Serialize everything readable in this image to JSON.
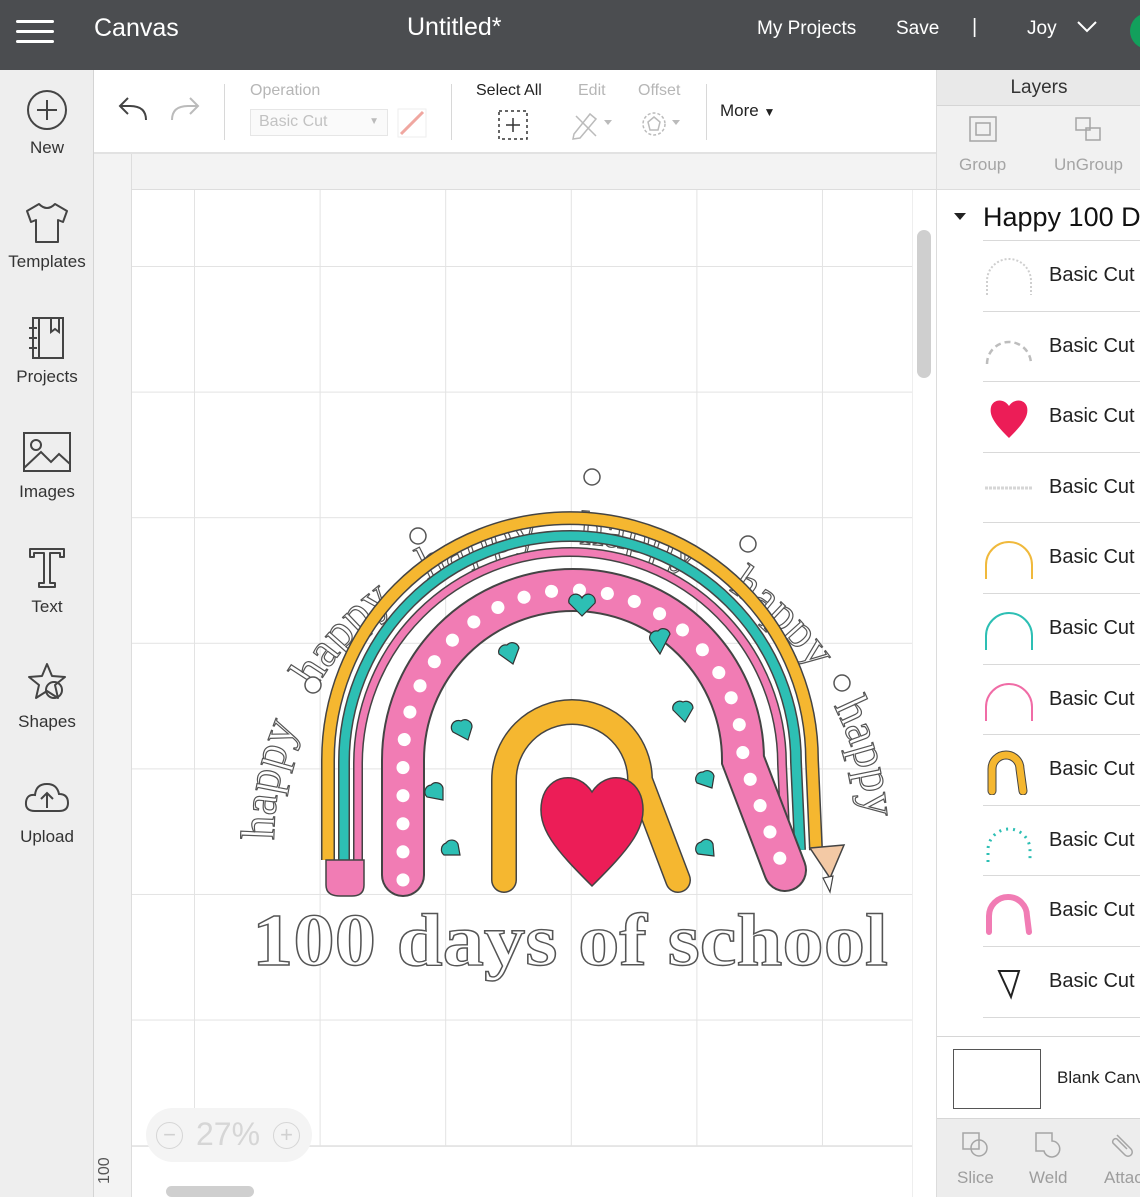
{
  "app": {
    "title": "Canvas",
    "document_title": "Untitled*",
    "nav": {
      "my_projects": "My Projects",
      "save": "Save",
      "separator": "|",
      "user": "Joy"
    }
  },
  "sidebar": {
    "items": [
      {
        "label": "New",
        "icon": "plus-circle-icon"
      },
      {
        "label": "Templates",
        "icon": "tshirt-icon"
      },
      {
        "label": "Projects",
        "icon": "notebook-icon"
      },
      {
        "label": "Images",
        "icon": "image-icon"
      },
      {
        "label": "Text",
        "icon": "text-t-icon"
      },
      {
        "label": "Shapes",
        "icon": "shapes-icon"
      },
      {
        "label": "Upload",
        "icon": "cloud-upload-icon"
      }
    ]
  },
  "toolbar": {
    "operation_label": "Operation",
    "operation_value": "Basic Cut",
    "select_all": "Select All",
    "edit": "Edit",
    "offset": "Offset",
    "more": "More"
  },
  "canvas": {
    "zoom": "27%",
    "ruler_left_label": "100",
    "design": {
      "arc_text": [
        "happy",
        "happy",
        "happy",
        "happy",
        "happy",
        "happy"
      ],
      "title": "100 days of school"
    }
  },
  "layers_panel": {
    "title": "Layers",
    "group_label": "Group",
    "ungroup_label": "UnGroup",
    "group_name": "Happy 100 D",
    "items": [
      {
        "label": "Basic Cut",
        "thumb": "dotted-arc-icon",
        "color": "#cfcfcf"
      },
      {
        "label": "Basic Cut",
        "thumb": "dashed-arc-icon",
        "color": "#bdbdbd"
      },
      {
        "label": "Basic Cut",
        "thumb": "heart-icon",
        "color": "#ec1d57"
      },
      {
        "label": "Basic Cut",
        "thumb": "text-line-icon",
        "color": "#d6d6d6"
      },
      {
        "label": "Basic Cut",
        "thumb": "arc-outline-icon",
        "color": "#f0b93c"
      },
      {
        "label": "Basic Cut",
        "thumb": "arc-outline-icon",
        "color": "#2dbfb4"
      },
      {
        "label": "Basic Cut",
        "thumb": "arc-outline-icon",
        "color": "#f06ca6"
      },
      {
        "label": "Basic Cut",
        "thumb": "arch-thick-icon",
        "color": "#f5b730"
      },
      {
        "label": "Basic Cut",
        "thumb": "dotted-arc-icon",
        "color": "#2dbfb4"
      },
      {
        "label": "Basic Cut",
        "thumb": "arch-thick-icon",
        "color": "#f17cb4"
      },
      {
        "label": "Basic Cut",
        "thumb": "triangle-outline-icon",
        "color": "#222222"
      }
    ],
    "blank_canvas": "Blank Canv",
    "bottom_tools": [
      "Slice",
      "Weld",
      "Attac"
    ]
  }
}
